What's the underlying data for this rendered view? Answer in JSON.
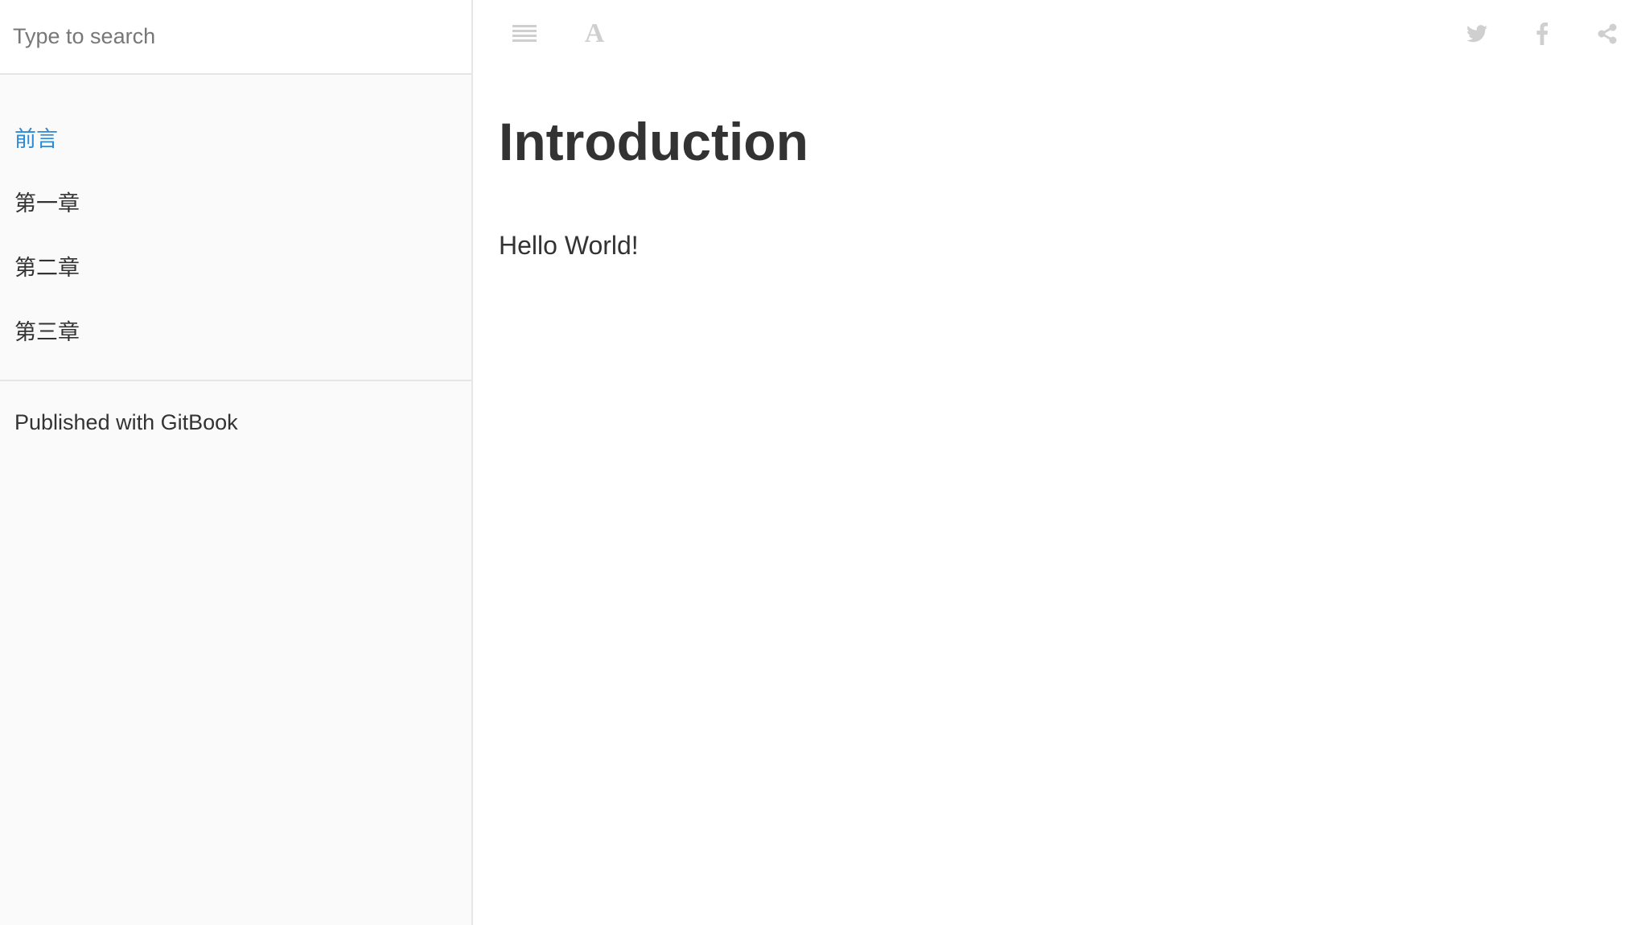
{
  "search": {
    "placeholder": "Type to search"
  },
  "sidebar": {
    "chapters": [
      {
        "label": "前言",
        "active": true
      },
      {
        "label": "第一章",
        "active": false
      },
      {
        "label": "第二章",
        "active": false
      },
      {
        "label": "第三章",
        "active": false
      }
    ],
    "footer_link": "Published with GitBook"
  },
  "header": {
    "icons": [
      "toc-icon",
      "font-settings-icon",
      "twitter-icon",
      "facebook-icon",
      "share-icon"
    ],
    "font_glyph": "A"
  },
  "page": {
    "title": "Introduction",
    "body": "Hello World!"
  },
  "colors": {
    "accent": "#2a8ad8",
    "text": "#333333",
    "icon": "#cfcfcf",
    "sidebar_bg": "#fafafa",
    "border": "#e6e6e6"
  }
}
